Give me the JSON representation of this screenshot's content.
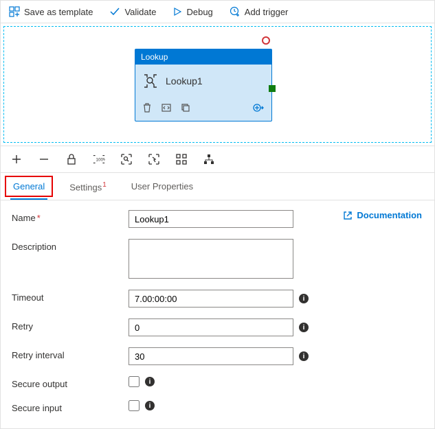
{
  "toolbar": {
    "save_template": "Save as template",
    "validate": "Validate",
    "debug": "Debug",
    "add_trigger": "Add trigger"
  },
  "activity": {
    "type_label": "Lookup",
    "name": "Lookup1"
  },
  "tabs": {
    "general": "General",
    "settings": "Settings",
    "settings_badge": "1",
    "user_properties": "User Properties"
  },
  "form": {
    "name_label": "Name",
    "name_value": "Lookup1",
    "description_label": "Description",
    "description_value": "",
    "timeout_label": "Timeout",
    "timeout_value": "7.00:00:00",
    "retry_label": "Retry",
    "retry_value": "0",
    "retry_interval_label": "Retry interval",
    "retry_interval_value": "30",
    "secure_output_label": "Secure output",
    "secure_input_label": "Secure input",
    "documentation": "Documentation"
  }
}
